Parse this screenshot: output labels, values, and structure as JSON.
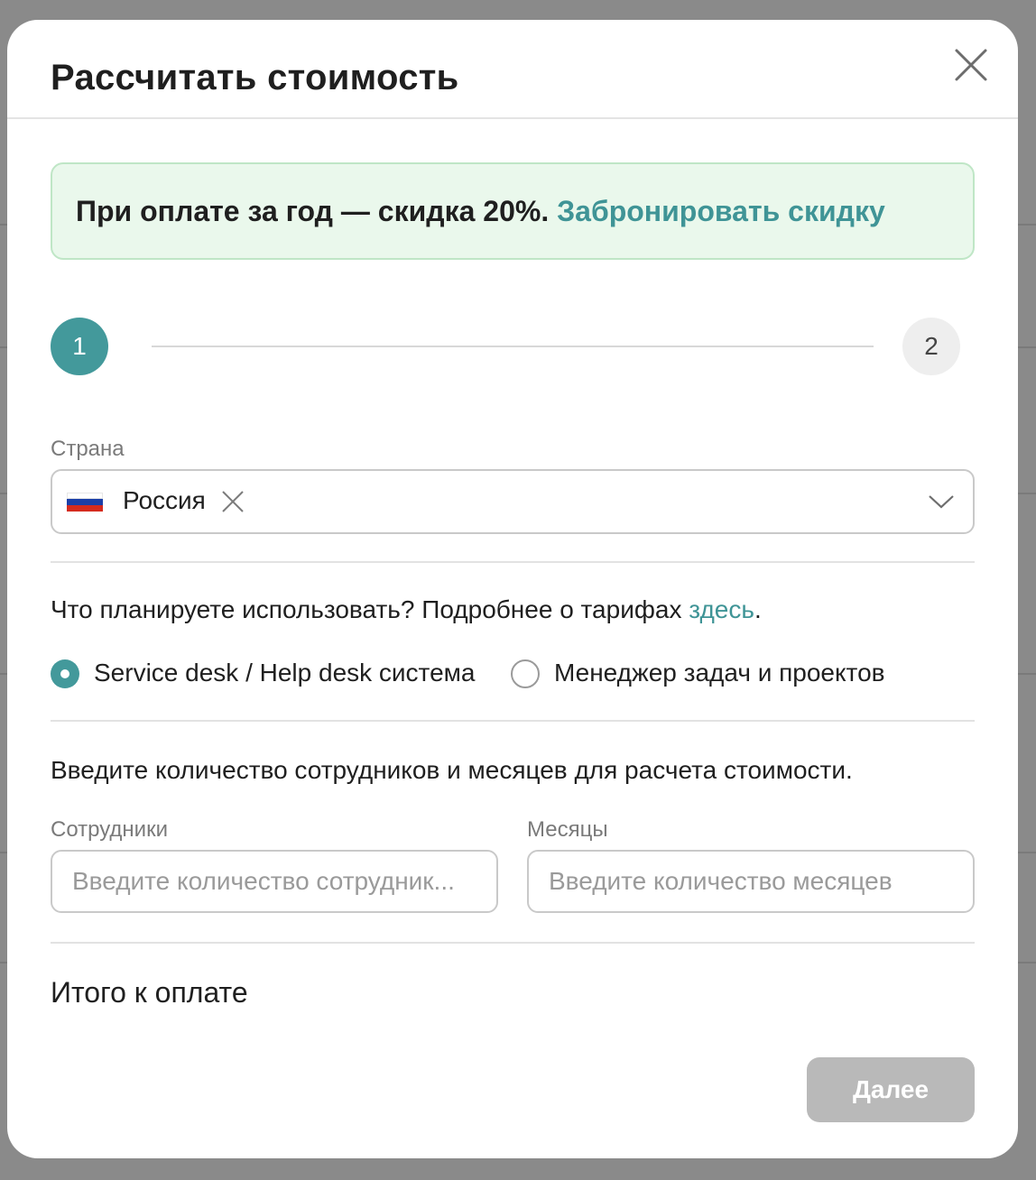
{
  "modal": {
    "title": "Рассчитать стоимость"
  },
  "promo": {
    "text": "При оплате за год — скидка 20%.",
    "link": "Забронировать скидку",
    "background_color": "#eaf8ec",
    "link_color": "#3f9496"
  },
  "stepper": {
    "steps": [
      "1",
      "2"
    ],
    "active_step": "1",
    "active_color": "#43999b"
  },
  "country": {
    "label": "Страна",
    "value": "Россия",
    "flag_icon": "russia-flag-icon"
  },
  "usage": {
    "question": "Что планируете использовать? Подробнее о тарифах ",
    "link": "здесь",
    "suffix": ".",
    "options": [
      {
        "label": "Service desk / Help desk система",
        "checked": true
      },
      {
        "label": "Менеджер задач и проектов",
        "checked": false
      }
    ]
  },
  "calc": {
    "instruction": "Введите количество сотрудников и месяцев для расчета стоимости.",
    "employees": {
      "label": "Сотрудники",
      "placeholder": "Введите количество сотрудник...",
      "value": ""
    },
    "months": {
      "label": "Месяцы",
      "placeholder": "Введите количество месяцев",
      "value": ""
    }
  },
  "total": {
    "label": "Итого к оплате"
  },
  "actions": {
    "next_label": "Далее",
    "next_disabled": true
  }
}
